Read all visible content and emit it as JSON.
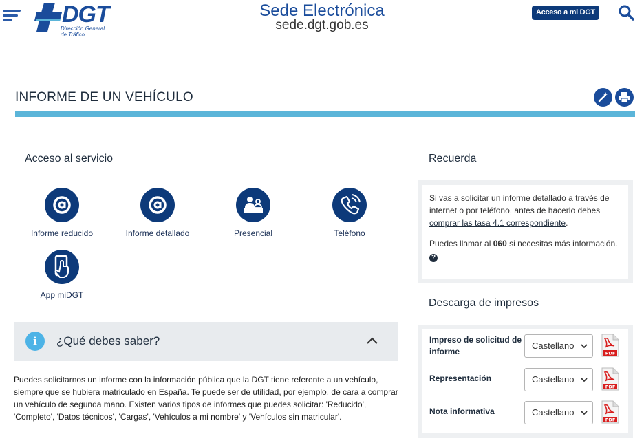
{
  "header": {
    "logo_text": "DGT",
    "logo_sub_line1": "Dirección General",
    "logo_sub_line2": "de Tráfico",
    "site_title": "Sede Electrónica",
    "site_url": "sede.dgt.gob.es",
    "acceso_label": "Acceso a mi DGT"
  },
  "page": {
    "title": "INFORME DE UN VEHÍCULO"
  },
  "acceso": {
    "heading": "Acceso al servicio",
    "items": [
      {
        "label": "Informe reducido",
        "icon": "at-sign-icon"
      },
      {
        "label": "Informe detallado",
        "icon": "at-sign-icon"
      },
      {
        "label": "Presencial",
        "icon": "person-desk-icon"
      },
      {
        "label": "Teléfono",
        "icon": "phone-icon"
      },
      {
        "label": "App miDGT",
        "icon": "mobile-app-icon"
      }
    ]
  },
  "faq": {
    "title": "¿Qué debes saber?",
    "body": "Puedes solicitarnos un informe con la información pública que la DGT tiene referente a un vehículo,  siempre que se hubiera matriculado en España. Te puede ser de utilidad, por ejemplo, de cara a comprar un vehículo de segunda mano. Existen varios tipos de informes que puedes solicitar: 'Reducido', 'Completo', 'Datos técnicos', 'Cargas', 'Vehículos a mi nombre' y 'Vehículos sin matricular'."
  },
  "recuerda": {
    "heading": "Recuerda",
    "p1_before": "Si vas a solicitar un informe detallado a través de internet o por teléfono, antes de hacerlo debes ",
    "p1_link": "comprar las tasa 4.1 correspondiente",
    "p1_after": ".",
    "p2_before": "Puedes llamar al ",
    "p2_bold": "060",
    "p2_after": " si necesitas más información."
  },
  "descarga": {
    "heading": "Descarga de impresos",
    "rows": [
      {
        "label": "Impreso de solicitud de informe",
        "selected": "Castellano"
      },
      {
        "label": "Representación",
        "selected": "Castellano"
      },
      {
        "label": "Nota informativa",
        "selected": "Castellano"
      }
    ]
  },
  "colors": {
    "primary": "#1a4c9b",
    "dark_primary": "#0d3a7a",
    "accent_bar": "#5bb5d9",
    "info": "#4db3e6",
    "pdf_red": "#d81e1e"
  }
}
